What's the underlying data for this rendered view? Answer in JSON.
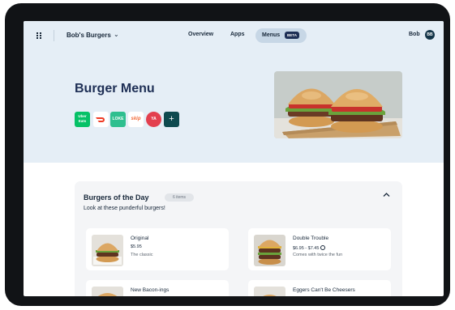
{
  "header": {
    "brand": "Bob's Burgers",
    "nav": {
      "overview": "Overview",
      "apps": "Apps",
      "menus": "Menus",
      "beta": "BETA"
    },
    "user": {
      "name": "Bob",
      "initials": "BB"
    }
  },
  "hero": {
    "title": "Burger Menu",
    "apps": [
      {
        "label": "Uber Eats",
        "color": "#06c167"
      },
      {
        "label": "",
        "icon": "doordash-icon",
        "color": "#ef3b24"
      },
      {
        "label": "LOKE",
        "color": "#2fbf8f"
      },
      {
        "label": "skip",
        "color": "#f26b3a"
      },
      {
        "label": "YA",
        "color": "#e33f4e"
      }
    ],
    "add_label": "+"
  },
  "section": {
    "title": "Burgers of the Day",
    "count": "6 items",
    "subtitle": "Look at these punderful burgers!",
    "items": [
      {
        "name": "Original",
        "price": "$5.95",
        "desc": "The classic"
      },
      {
        "name": "Double Trouble",
        "price": "$6.95 - $7.45",
        "desc": "Comes with twice the fun"
      },
      {
        "name": "New Bacon-ings",
        "price": "",
        "desc": ""
      },
      {
        "name": "Eggers Can't Be Cheesers",
        "price": "",
        "desc": ""
      }
    ]
  },
  "colors": {
    "navy": "#1e2f55",
    "hero_bg": "#e5eef6",
    "menus_pill": "#c7d7e6"
  }
}
